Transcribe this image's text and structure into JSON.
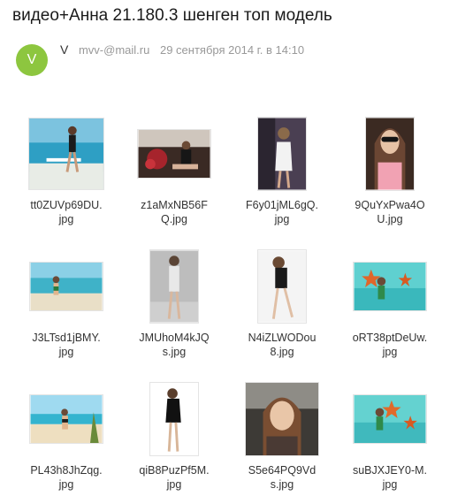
{
  "message": {
    "subject": "видео+Анна 21.180.3 шенген топ модель",
    "sender": {
      "avatar_letter": "V",
      "name": "V",
      "email": "mvv-@mail.ru",
      "date": "29 сентября 2014 г. в 14:10",
      "avatar_color": "#8dc63f"
    }
  },
  "attachments": [
    {
      "line1": "tt0ZUVp69DU.",
      "line2": "jpg",
      "icon": "photo-thumbnail"
    },
    {
      "line1": "z1aMxNB56F",
      "line2": "Q.jpg",
      "icon": "photo-thumbnail"
    },
    {
      "line1": "F6y01jML6gQ.",
      "line2": "jpg",
      "icon": "photo-thumbnail"
    },
    {
      "line1": "9QuYxPwa4O",
      "line2": "U.jpg",
      "icon": "photo-thumbnail"
    },
    {
      "line1": "J3LTsd1jBMY.",
      "line2": "jpg",
      "icon": "photo-thumbnail"
    },
    {
      "line1": "JMUhoM4kJQ",
      "line2": "s.jpg",
      "icon": "photo-thumbnail"
    },
    {
      "line1": "N4iZLWODou",
      "line2": "8.jpg",
      "icon": "photo-thumbnail"
    },
    {
      "line1": "oRT38ptDeUw.",
      "line2": "jpg",
      "icon": "photo-thumbnail"
    },
    {
      "line1": "PL43h8JhZqg.",
      "line2": "jpg",
      "icon": "photo-thumbnail"
    },
    {
      "line1": "qiB8PuzPf5M.",
      "line2": "jpg",
      "icon": "photo-thumbnail"
    },
    {
      "line1": "S5e64PQ9Vd",
      "line2": "s.jpg",
      "icon": "photo-thumbnail"
    },
    {
      "line1": "suBJXJEY0-M.",
      "line2": "jpg",
      "icon": "photo-thumbnail"
    }
  ]
}
